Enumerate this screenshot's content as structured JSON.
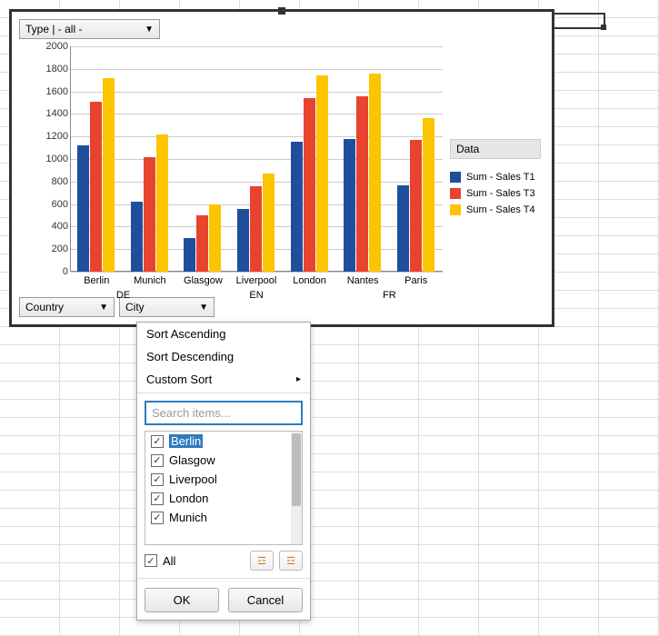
{
  "filters": {
    "type_label": "Type | - all -",
    "country_label": "Country",
    "city_label": "City"
  },
  "legend": {
    "title": "Data",
    "items": [
      {
        "label": "Sum - Sales T1",
        "color": "#1f4e9c"
      },
      {
        "label": "Sum - Sales T3",
        "color": "#e8432e"
      },
      {
        "label": "Sum - Sales T4",
        "color": "#fdc400"
      }
    ]
  },
  "popup": {
    "sort_asc": "Sort Ascending",
    "sort_desc": "Sort Descending",
    "custom_sort": "Custom Sort",
    "search_placeholder": "Search items...",
    "items": [
      {
        "label": "Berlin",
        "checked": true,
        "selected": true
      },
      {
        "label": "Glasgow",
        "checked": true,
        "selected": false
      },
      {
        "label": "Liverpool",
        "checked": true,
        "selected": false
      },
      {
        "label": "London",
        "checked": true,
        "selected": false
      },
      {
        "label": "Munich",
        "checked": true,
        "selected": false
      }
    ],
    "all_label": "All",
    "all_checked": true,
    "ok_label": "OK",
    "cancel_label": "Cancel"
  },
  "chart_data": {
    "type": "bar",
    "title": "",
    "xlabel": "",
    "ylabel": "",
    "ylim": [
      0,
      2000
    ],
    "y_ticks": [
      0,
      200,
      400,
      600,
      800,
      1000,
      1200,
      1400,
      1600,
      1800,
      2000
    ],
    "categories": [
      "Berlin",
      "Munich",
      "Glasgow",
      "Liverpool",
      "London",
      "Nantes",
      "Paris"
    ],
    "country_groups": [
      {
        "label": "DE",
        "span": [
          "Berlin",
          "Munich"
        ]
      },
      {
        "label": "EN",
        "span": [
          "Glasgow",
          "Liverpool",
          "London"
        ]
      },
      {
        "label": "FR",
        "span": [
          "Nantes",
          "Paris"
        ]
      }
    ],
    "series": [
      {
        "name": "Sum - Sales T1",
        "color": "#1f4e9c",
        "values": [
          1120,
          620,
          300,
          560,
          1150,
          1180,
          770
        ]
      },
      {
        "name": "Sum - Sales T3",
        "color": "#e8432e",
        "values": [
          1510,
          1020,
          500,
          760,
          1540,
          1560,
          1170
        ]
      },
      {
        "name": "Sum - Sales T4",
        "color": "#fdc400",
        "values": [
          1720,
          1220,
          600,
          870,
          1740,
          1760,
          1360
        ]
      }
    ]
  }
}
